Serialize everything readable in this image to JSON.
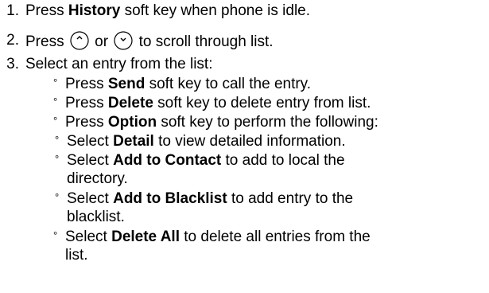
{
  "step1": {
    "number": "1.",
    "pre": "Press ",
    "key": "History",
    "post": " soft key when phone is idle."
  },
  "step2": {
    "number": "2.",
    "pre": "Press ",
    "up_icon": "up-arrow-key-icon",
    "mid": " or ",
    "down_icon": "down-arrow-key-icon",
    "post": " to scroll through list."
  },
  "step3": {
    "number": "3.",
    "text": "Select an entry from the list:",
    "bullet_glyph": "°",
    "items": [
      {
        "pre": "Press ",
        "key": "Send",
        "post": " soft key to call the entry."
      },
      {
        "pre": "Press ",
        "key": "Delete",
        "post": " soft key to delete entry from list."
      },
      {
        "pre": "Press ",
        "key": "Option",
        "post": " soft key to perform the following:"
      }
    ],
    "sub_items": [
      {
        "pre": "Select ",
        "key": "Detail",
        "post": " to view detailed information."
      },
      {
        "pre": "Select ",
        "key": "Add to Contact",
        "post": " to add to local the",
        "cont": "directory."
      },
      {
        "pre": "Select ",
        "key": "Add to Blacklist",
        "post": " to add entry to the",
        "cont": "blacklist."
      }
    ],
    "last_item": {
      "pre": "Select ",
      "key": "Delete All",
      "post": " to delete all entries from the",
      "cont": "list."
    }
  }
}
